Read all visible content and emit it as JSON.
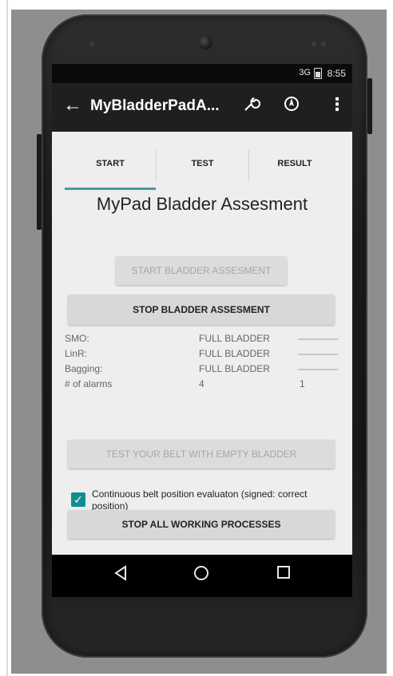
{
  "status": {
    "signal": "3G",
    "time": "8:55"
  },
  "app": {
    "title": "MyBladderPadA..."
  },
  "tabs": [
    "START",
    "TEST",
    "RESULT"
  ],
  "main": {
    "heading": "MyPad Bladder Assesment",
    "start_button": "START BLADDER ASSESMENT",
    "stop_button": "STOP BLADDER ASSESMENT",
    "rows": [
      {
        "label": "SMO:",
        "value": "FULL BLADDER"
      },
      {
        "label": "LinR:",
        "value": "FULL BLADDER"
      },
      {
        "label": "Bagging:",
        "value": "FULL BLADDER"
      },
      {
        "label": "# of alarms",
        "value": "4",
        "extra": "1"
      }
    ],
    "test_button": "TEST YOUR BELT WITH EMPTY BLADDER",
    "checkbox": {
      "label": "Continuous belt position evaluaton (signed: correct position)",
      "checked": true
    },
    "stop_all_button": "STOP ALL WORKING PROCESSES"
  },
  "colors": {
    "accent": "#138d8d",
    "tab_underline": "#4a9a9a"
  },
  "icons": [
    "back-arrow-icon",
    "wrench-icon",
    "navigation-icon",
    "overflow-menu-icon",
    "nav-back-icon",
    "nav-home-icon",
    "nav-recents-icon"
  ]
}
